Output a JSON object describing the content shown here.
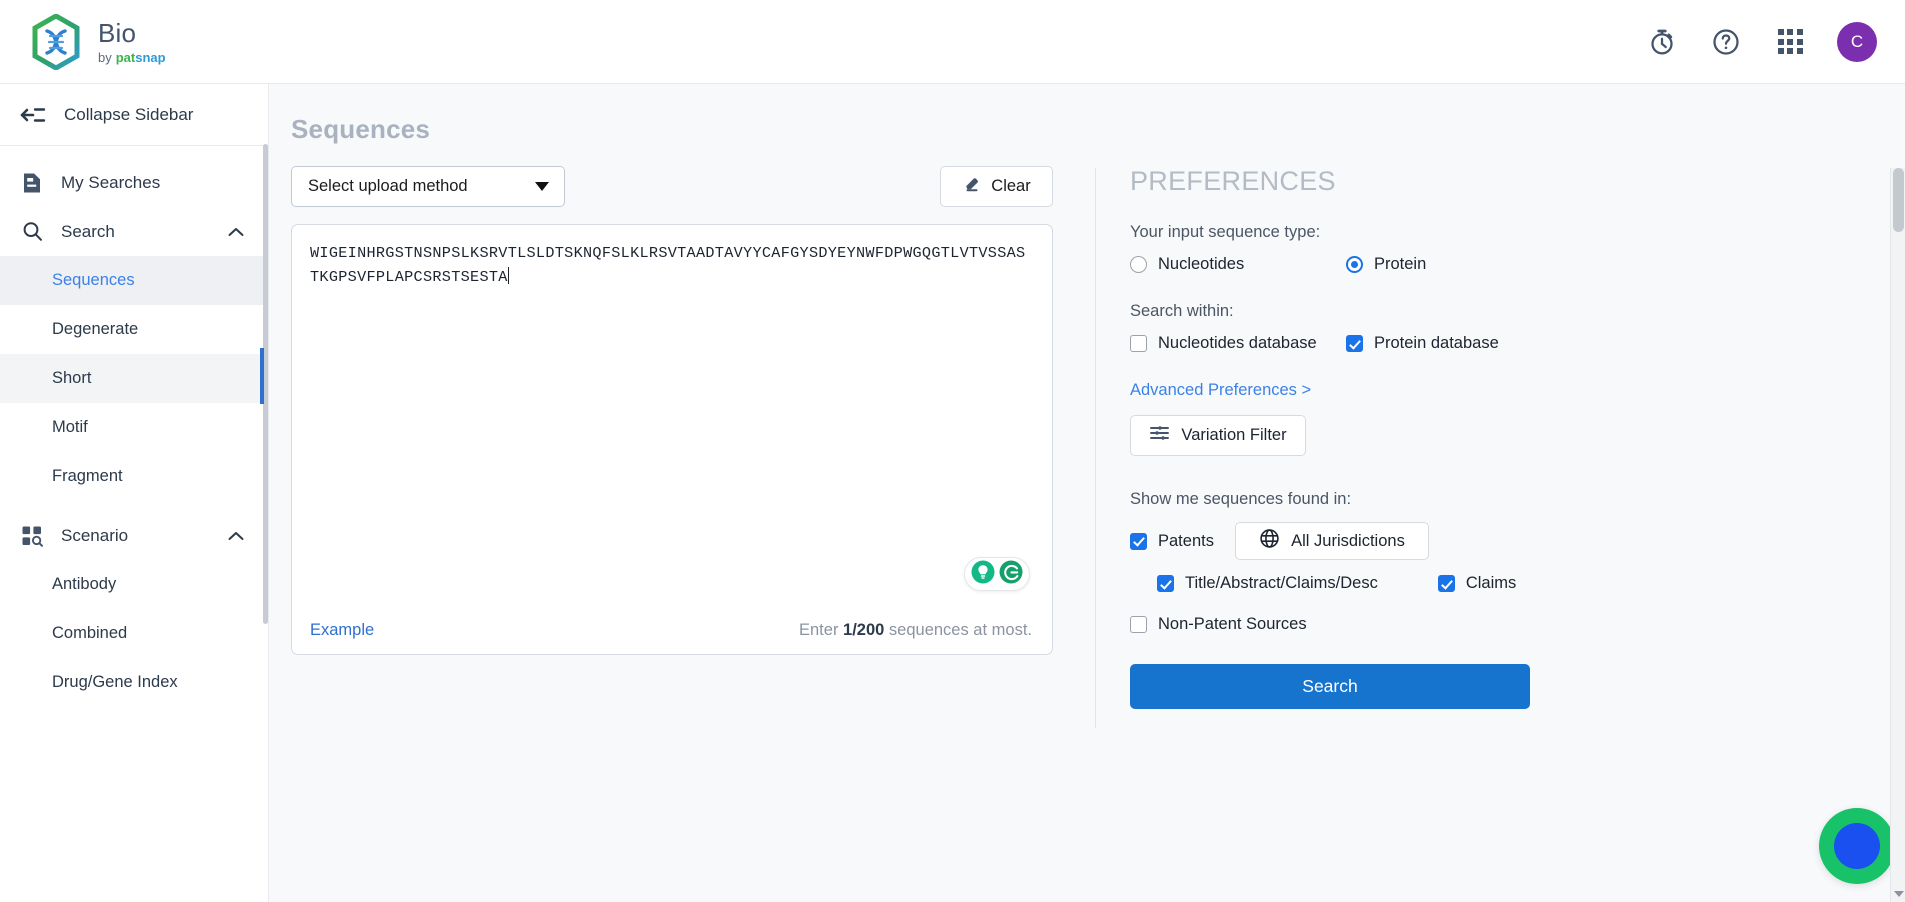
{
  "header": {
    "brand_title": "Bio",
    "brand_by": "by",
    "brand_pat": "pat",
    "brand_s": "s",
    "brand_nap": "nap",
    "icons": {
      "timer": "stopwatch-icon",
      "help": "help-circle-icon",
      "apps": "apps-grid-icon"
    },
    "avatar_initial": "C",
    "avatar_color": "#7b2fae"
  },
  "sidebar": {
    "collapse_label": "Collapse Sidebar",
    "items": [
      {
        "label": "My Searches",
        "icon": "document-icon",
        "type": "top"
      },
      {
        "label": "Search",
        "icon": "search-icon",
        "type": "group"
      },
      {
        "label": "Sequences",
        "type": "sub",
        "state": "active"
      },
      {
        "label": "Degenerate",
        "type": "sub",
        "state": "normal"
      },
      {
        "label": "Short",
        "type": "sub",
        "state": "hover"
      },
      {
        "label": "Motif",
        "type": "sub",
        "state": "normal"
      },
      {
        "label": "Fragment",
        "type": "sub",
        "state": "normal"
      },
      {
        "label": "Scenario",
        "icon": "scenario-icon",
        "type": "group"
      },
      {
        "label": "Antibody",
        "type": "sub",
        "state": "normal"
      },
      {
        "label": "Combined",
        "type": "sub",
        "state": "normal"
      },
      {
        "label": "Drug/Gene Index",
        "type": "sub",
        "state": "normal"
      }
    ],
    "active_color": "#3b82e8"
  },
  "main": {
    "page_title": "Sequences",
    "upload_select": {
      "value": "Select upload method"
    },
    "clear_button": "Clear",
    "sequence_value": "WIGEINHRGSTNSNPSLKSRVTLSLDTSKNQFSLKLRSVTAADTAVYYCAFGYSDYEYNWFDPWGQGTLVTVSSASTKGPSVFPLAPCSRSTSESTA",
    "example_link": "Example",
    "count_prefix": "Enter ",
    "count_value": "1/200",
    "count_suffix": " sequences at most.",
    "grammarly_icons": [
      "bulb-icon",
      "grammarly-g-icon"
    ]
  },
  "preferences": {
    "title": "PREFERENCES",
    "input_type_label": "Your input sequence type:",
    "input_types": [
      {
        "label": "Nucleotides",
        "checked": false
      },
      {
        "label": "Protein",
        "checked": true
      }
    ],
    "search_within_label": "Search within:",
    "databases": [
      {
        "label": "Nucleotides database",
        "checked": false
      },
      {
        "label": "Protein database",
        "checked": true
      }
    ],
    "advanced_link": "Advanced Preferences >",
    "variation_filter": "Variation Filter",
    "show_in_label": "Show me sequences found in:",
    "patents": {
      "label": "Patents",
      "checked": true
    },
    "jurisdictions_button": "All Jurisdictions",
    "patent_scopes": [
      {
        "label": "Title/Abstract/Claims/Desc",
        "checked": true
      },
      {
        "label": "Claims",
        "checked": true
      }
    ],
    "non_patent": {
      "label": "Non-Patent Sources",
      "checked": false
    },
    "search_button": "Search",
    "accent_color": "#1a73e8",
    "search_button_color": "#1674ce"
  }
}
